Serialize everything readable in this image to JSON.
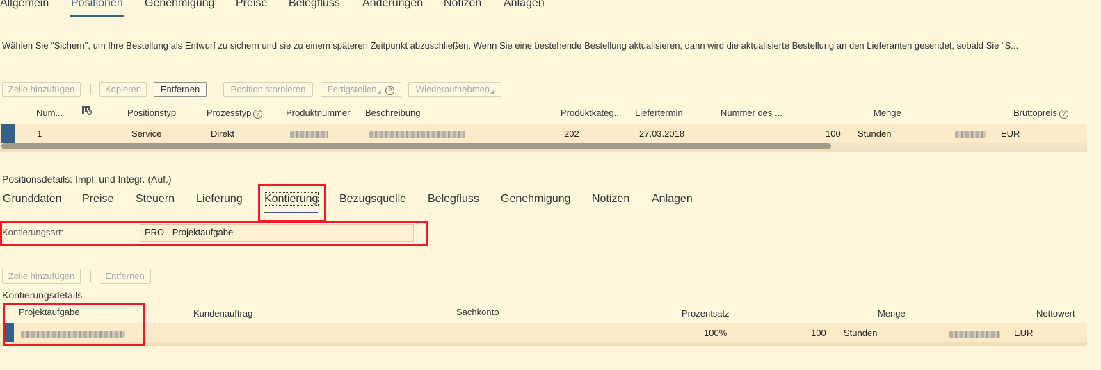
{
  "top_tabs": [
    "Allgemein",
    "Positionen",
    "Genehmigung",
    "Preise",
    "Belegfluss",
    "Änderungen",
    "Notizen",
    "Anlagen"
  ],
  "top_active": "Positionen",
  "info_text": "Wählen Sie \"Sichern\", um Ihre Bestellung als Entwurf zu sichern und sie zu einem späteren Zeitpunkt abzuschließen. Wenn Sie eine bestehende Bestellung aktualisieren, dann wird die aktualisierte Bestellung an den Lieferanten gesendet, sobald Sie \"S...",
  "toolbar1": {
    "add_row": "Zeile hinzufügen",
    "copy": "Kopieren",
    "remove": "Entfernen",
    "cancel_position": "Position stornieren",
    "complete": "Fertigstellen",
    "resume": "Wiederaufnehmen"
  },
  "positions_table": {
    "headers": {
      "num": "Num...",
      "positionstyp": "Positionstyp",
      "prozesstyp": "Prozesstyp",
      "produktnummer": "Produktnummer",
      "beschreibung": "Beschreibung",
      "produktkategorie": "Produktkateg...",
      "liefertermin": "Liefertermin",
      "nummer_des": "Nummer des ...",
      "menge": "Menge",
      "bruttopreis": "Bruttopreis"
    },
    "row": {
      "num": "1",
      "positionstyp": "Service",
      "prozesstyp": "Direkt",
      "produktkategorie": "202",
      "liefertermin": "27.03.2018",
      "menge": "100",
      "einheit": "Stunden",
      "waehrung": "EUR"
    }
  },
  "details_title": "Positionsdetails: Impl. und Integr. (Auf.)",
  "sub_tabs": [
    "Grunddaten",
    "Preise",
    "Steuern",
    "Lieferung",
    "Kontierung",
    "Bezugsquelle",
    "Belegfluss",
    "Genehmigung",
    "Notizen",
    "Anlagen"
  ],
  "sub_active": "Kontierung",
  "kontierungsart": {
    "label": "Kontierungsart:",
    "value": "PRO - Projektaufgabe"
  },
  "toolbar2": {
    "add_row": "Zeile hinzufügen",
    "remove": "Entfernen"
  },
  "kontierungsdetails_title": "Kontierungsdetails",
  "kontierung_table": {
    "headers": {
      "projektaufgabe": "Projektaufgabe",
      "kundenauftrag": "Kundenauftrag",
      "sachkonto": "Sachkonto",
      "prozentsatz": "Prozentsatz",
      "menge": "Menge",
      "nettowert": "Nettowert"
    },
    "row": {
      "prozentsatz": "100%",
      "menge": "100",
      "einheit": "Stunden",
      "waehrung": "EUR"
    }
  },
  "colors": {
    "background": "#fff6dc",
    "accent": "#346187",
    "highlight_box": "#ee1b24",
    "row_selected": "#fcebc8"
  }
}
